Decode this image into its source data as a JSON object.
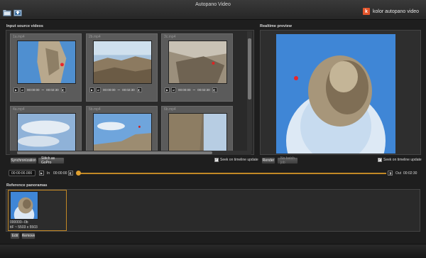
{
  "window": {
    "title": "Autopano Video"
  },
  "brand": {
    "text": "kolor autopano video",
    "logo_letter": "k",
    "logo_color": "#e4552b"
  },
  "toolbar": {
    "icons": [
      "open-folder-icon",
      "export-icon"
    ]
  },
  "source": {
    "label": "Input source videos",
    "tiles": [
      {
        "name": "1a.mp4",
        "time": "00:00:00",
        "duration": "00:02:30"
      },
      {
        "name": "2b.mp4",
        "time": "00:00:00",
        "duration": "00:02:30"
      },
      {
        "name": "3c.mp4",
        "time": "00:00:00",
        "duration": "00:02:30"
      },
      {
        "name": "4a.mp4"
      },
      {
        "name": "5b.mp4"
      },
      {
        "name": "6b.mp4"
      }
    ],
    "sync_button": "Synchronization",
    "stitch_button": "Stitch  as GoPro",
    "seek_label": "Seek on timeline update"
  },
  "preview": {
    "label": "Realtime preview",
    "render_button": "Render",
    "batch_button": "No batch job",
    "seek_label": "Seek on timeline update"
  },
  "timeline": {
    "current_time": "00:00:00.000",
    "in_label": "In",
    "in_time": "00:00:00",
    "out_label": "Out",
    "out_time": "00:02:30",
    "accent": "#c28826"
  },
  "reference": {
    "label": "Reference panoramas",
    "item_name": "000000--0b",
    "item_info": "tiF ~ 5503 x 5503",
    "edit_button": "Edit",
    "remove_button": "Remove"
  }
}
